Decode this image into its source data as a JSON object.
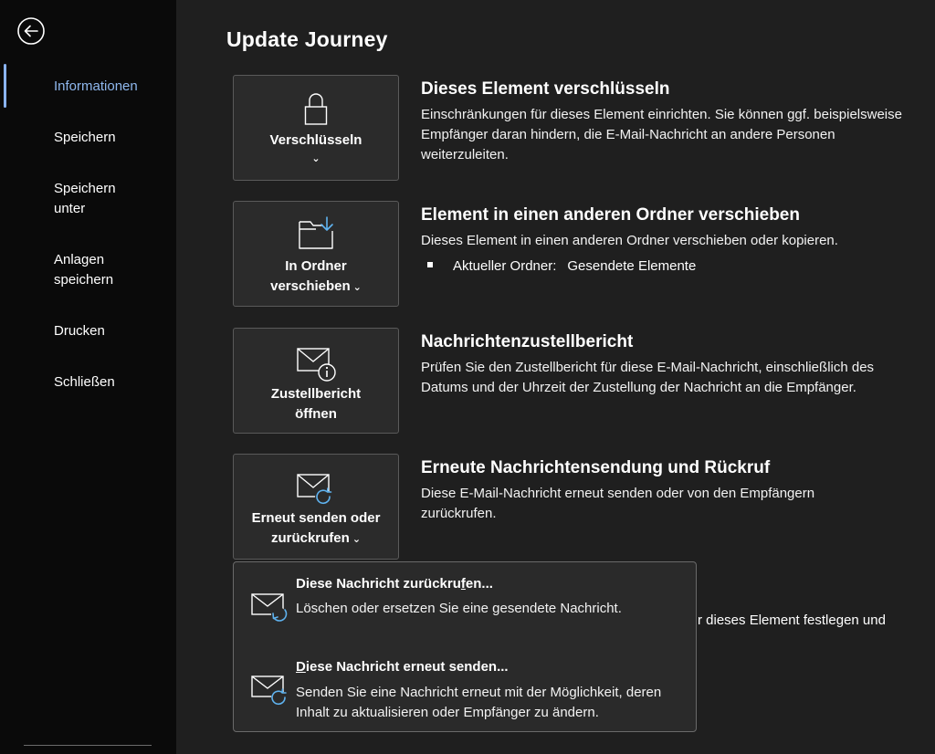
{
  "page": {
    "title": "Update Journey"
  },
  "sidebar": {
    "items": [
      {
        "label": "Informationen",
        "active": true
      },
      {
        "label": "Speichern"
      },
      {
        "label": "Speichern unter"
      },
      {
        "label": "Anlagen speichern"
      },
      {
        "label": "Drucken"
      },
      {
        "label": "Schließen"
      }
    ]
  },
  "sections": {
    "encrypt": {
      "button_label": "Verschlüsseln",
      "title": "Dieses Element verschlüsseln",
      "description": "Einschränkungen für dieses Element einrichten. Sie können ggf. beispielsweise Empfänger daran hindern, die E-Mail-Nachricht an andere Personen weiterzuleiten."
    },
    "move": {
      "button_label_1": "In Ordner",
      "button_label_2": "verschieben",
      "title": "Element in einen anderen Ordner verschieben",
      "description": "Dieses Element in einen anderen Ordner verschieben oder kopieren.",
      "folder_label": "Aktueller Ordner:",
      "folder_value": "Gesendete Elemente"
    },
    "delivery_report": {
      "button_label_1": "Zustellbericht",
      "button_label_2": "öffnen",
      "title": "Nachrichtenzustellbericht",
      "description": "Prüfen Sie den Zustellbericht für diese E-Mail-Nachricht, einschließlich des Datums und der Uhrzeit der Zustellung der Nachricht an die Empfänger."
    },
    "resend": {
      "button_label_1": "Erneut senden oder",
      "button_label_2": "zurückrufen",
      "title": "Erneute Nachrichtensendung und Rückruf",
      "description": "Diese E-Mail-Nachricht erneut senden oder von den Empfängern zurückrufen."
    },
    "partial_text": "r dieses Element festlegen und"
  },
  "dropdown": {
    "items": [
      {
        "title_pre": "Diese Nachricht zurückru",
        "title_key": "f",
        "title_post": "en...",
        "description": "Löschen oder ersetzen Sie eine gesendete Nachricht."
      },
      {
        "title_key": "D",
        "title_post": "iese Nachricht erneut senden...",
        "description": "Senden Sie eine Nachricht erneut mit der Möglichkeit, deren Inhalt zu aktualisieren oder Empfänger zu ändern."
      }
    ]
  },
  "icons": {
    "back": "back-arrow-icon",
    "encrypt": "lock-icon",
    "move": "folder-move-icon",
    "delivery": "mail-info-icon",
    "resend": "mail-resend-icon",
    "recall": "mail-recall-icon"
  },
  "colors": {
    "accent": "#8fb8ee",
    "background": "#1f1f1f",
    "sidebar": "#0a0a0a"
  }
}
